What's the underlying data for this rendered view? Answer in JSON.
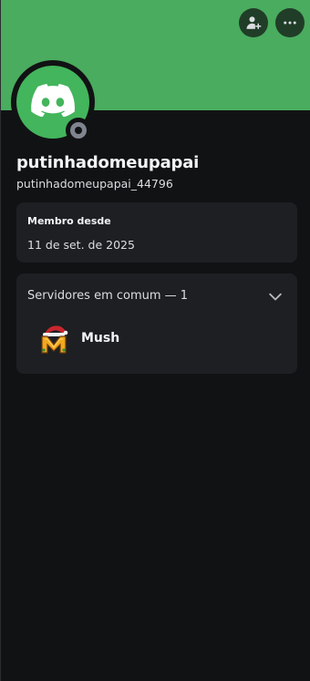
{
  "profile": {
    "banner_color": "#4aac5e",
    "avatar_color": "#43b55c",
    "display_name": "putinhadomeupapai",
    "username": "putinhadomeupapai_44796",
    "status": "offline",
    "status_color": "#80848e"
  },
  "header": {
    "add_friend_icon": "add-friend-icon",
    "more_icon": "more-icon"
  },
  "member_since": {
    "label": "Membro desde",
    "date": "11 de set. de 2025"
  },
  "mutual_servers": {
    "label": "Servidores em comum — 1",
    "expand_icon": "chevron-down-icon",
    "servers": [
      {
        "name": "Mush",
        "icon": "mush-server-icon"
      }
    ]
  }
}
